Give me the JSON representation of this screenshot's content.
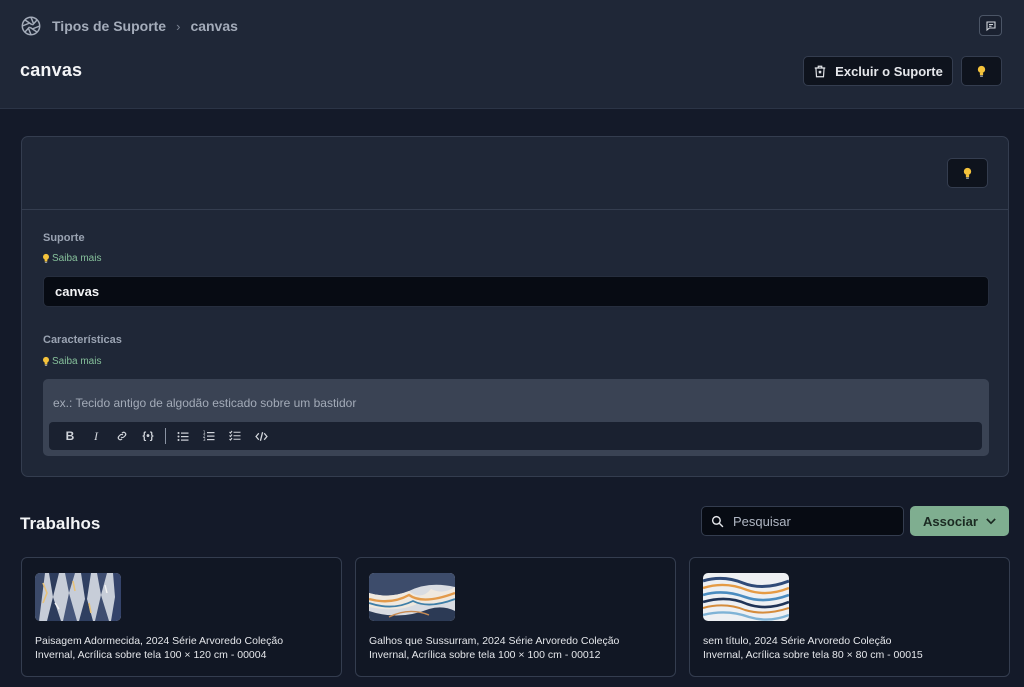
{
  "breadcrumb": {
    "parent": "Tipos de Suporte",
    "current": "canvas"
  },
  "page": {
    "title": "canvas"
  },
  "header": {
    "delete_label": "Excluir o Suporte"
  },
  "form": {
    "suporte_label": "Suporte",
    "suporte_learn_more": "Saiba mais",
    "suporte_value": "canvas",
    "caracteristicas_label": "Características",
    "caracteristicas_learn_more": "Saiba mais",
    "caracteristicas_placeholder": "ex.: Tecido antigo de algodão esticado sobre um bastidor",
    "toolbar": [
      "bold-icon",
      "italic-icon",
      "link-icon",
      "variable-icon",
      "bullet-list-icon",
      "numbered-list-icon",
      "checklist-icon",
      "code-icon"
    ]
  },
  "works": {
    "title": "Trabalhos",
    "search_placeholder": "Pesquisar",
    "associate_label": "Associar",
    "items": [
      {
        "line1": "Paisagem Adormecida, 2024 Série Arvoredo Coleção",
        "line2": "Invernal, Acrílica sobre tela 100 × 120 cm - 00004"
      },
      {
        "line1": "Galhos que Sussurram, 2024 Série Arvoredo Coleção",
        "line2": "Invernal, Acrílica sobre tela 100 × 100 cm - 00012"
      },
      {
        "line1": "sem título, 2024 Série Arvoredo Coleção",
        "line2": "Invernal, Acrílica sobre tela 80 × 80 cm - 00015"
      }
    ]
  },
  "colors": {
    "accent": "#7fae90",
    "bulb": "#f5c33b",
    "link": "#86c09b"
  }
}
